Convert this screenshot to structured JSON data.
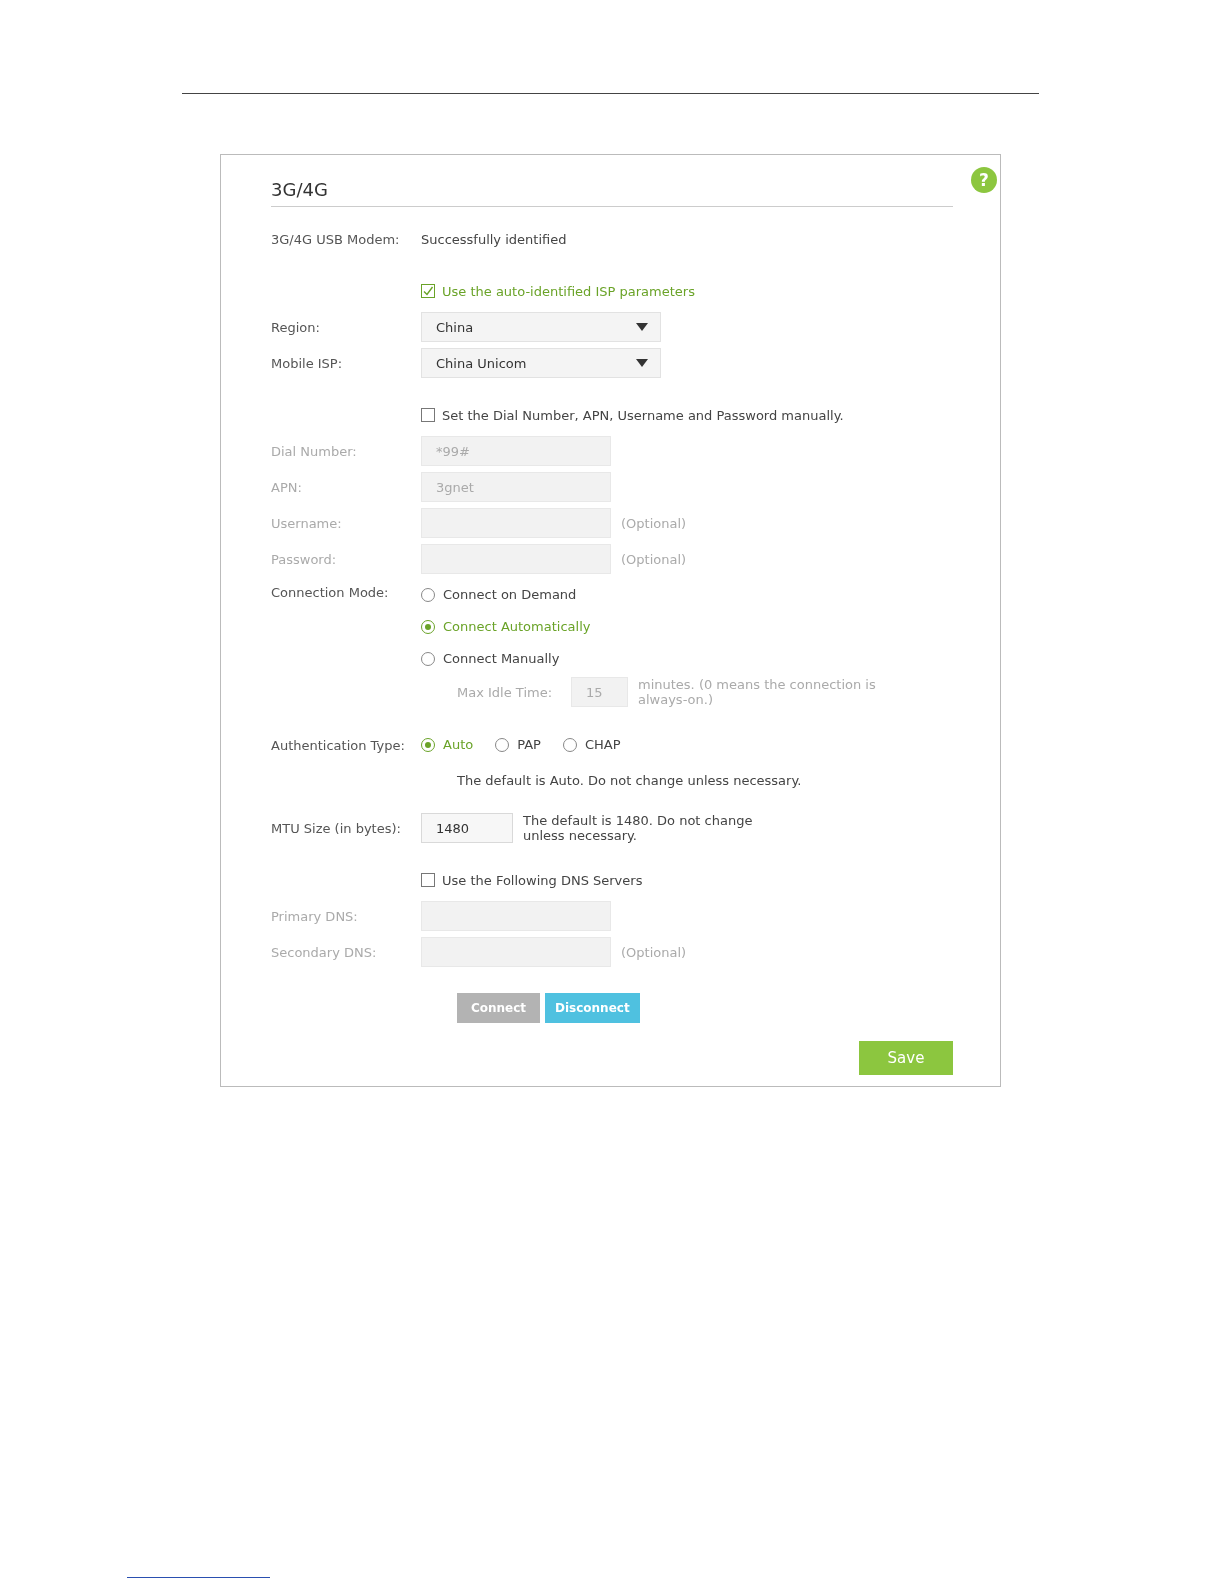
{
  "panel": {
    "title": "3G/4G",
    "help": "?",
    "rows": [
      {
        "kind": "info",
        "label": "3G/4G USB Modem:",
        "value": "Successfully identified"
      },
      {
        "kind": "checkbox",
        "text": "Use the auto-identified ISP parameters",
        "checked": true
      },
      {
        "kind": "select",
        "label": "Region:",
        "value": "China"
      },
      {
        "kind": "select",
        "label": "Mobile ISP:",
        "value": "China Unicom"
      },
      {
        "kind": "checkbox",
        "text": "Set the Dial Number, APN, Username and Password manually.",
        "checked": false
      },
      {
        "kind": "text",
        "label": "Dial Number:",
        "value": "*99#",
        "disabled": true
      },
      {
        "kind": "text",
        "label": "APN:",
        "value": "3gnet",
        "disabled": true
      },
      {
        "kind": "text",
        "label": "Username:",
        "note": "(Optional)",
        "disabled": true
      },
      {
        "kind": "text",
        "label": "Password:",
        "note": "(Optional)",
        "disabled": true
      },
      {
        "kind": "radio-column",
        "label": "Connection Mode:",
        "options": [
          {
            "text": "Connect on Demand",
            "selected": false
          },
          {
            "text": "Connect Automatically",
            "selected": true
          },
          {
            "text": "Connect Manually",
            "selected": false
          }
        ]
      },
      {
        "kind": "idle",
        "label": "Max Idle Time:",
        "value": "15",
        "note": "minutes. (0 means the connection is always-on.)",
        "disabled": true
      },
      {
        "kind": "radio-row",
        "label": "Authentication Type:",
        "options": [
          {
            "text": "Auto",
            "selected": true
          },
          {
            "text": "PAP",
            "selected": false
          },
          {
            "text": "CHAP",
            "selected": false
          }
        ]
      },
      {
        "kind": "hint",
        "text": "The default is Auto. Do not change unless necessary."
      },
      {
        "kind": "mtu",
        "label": "MTU Size (in bytes):",
        "value": "1480",
        "note": "The default is 1480. Do not change unless necessary."
      },
      {
        "kind": "checkbox",
        "text": "Use the Following DNS Servers",
        "checked": false
      },
      {
        "kind": "text",
        "label": "Primary DNS:",
        "disabled": true
      },
      {
        "kind": "text",
        "label": "Secondary DNS:",
        "note": "(Optional)",
        "disabled": true
      },
      {
        "kind": "buttons",
        "buttons": [
          {
            "label": "Connect",
            "disabled": true
          },
          {
            "label": "Disconnect",
            "disabled": false
          }
        ]
      }
    ],
    "save": "Save"
  }
}
